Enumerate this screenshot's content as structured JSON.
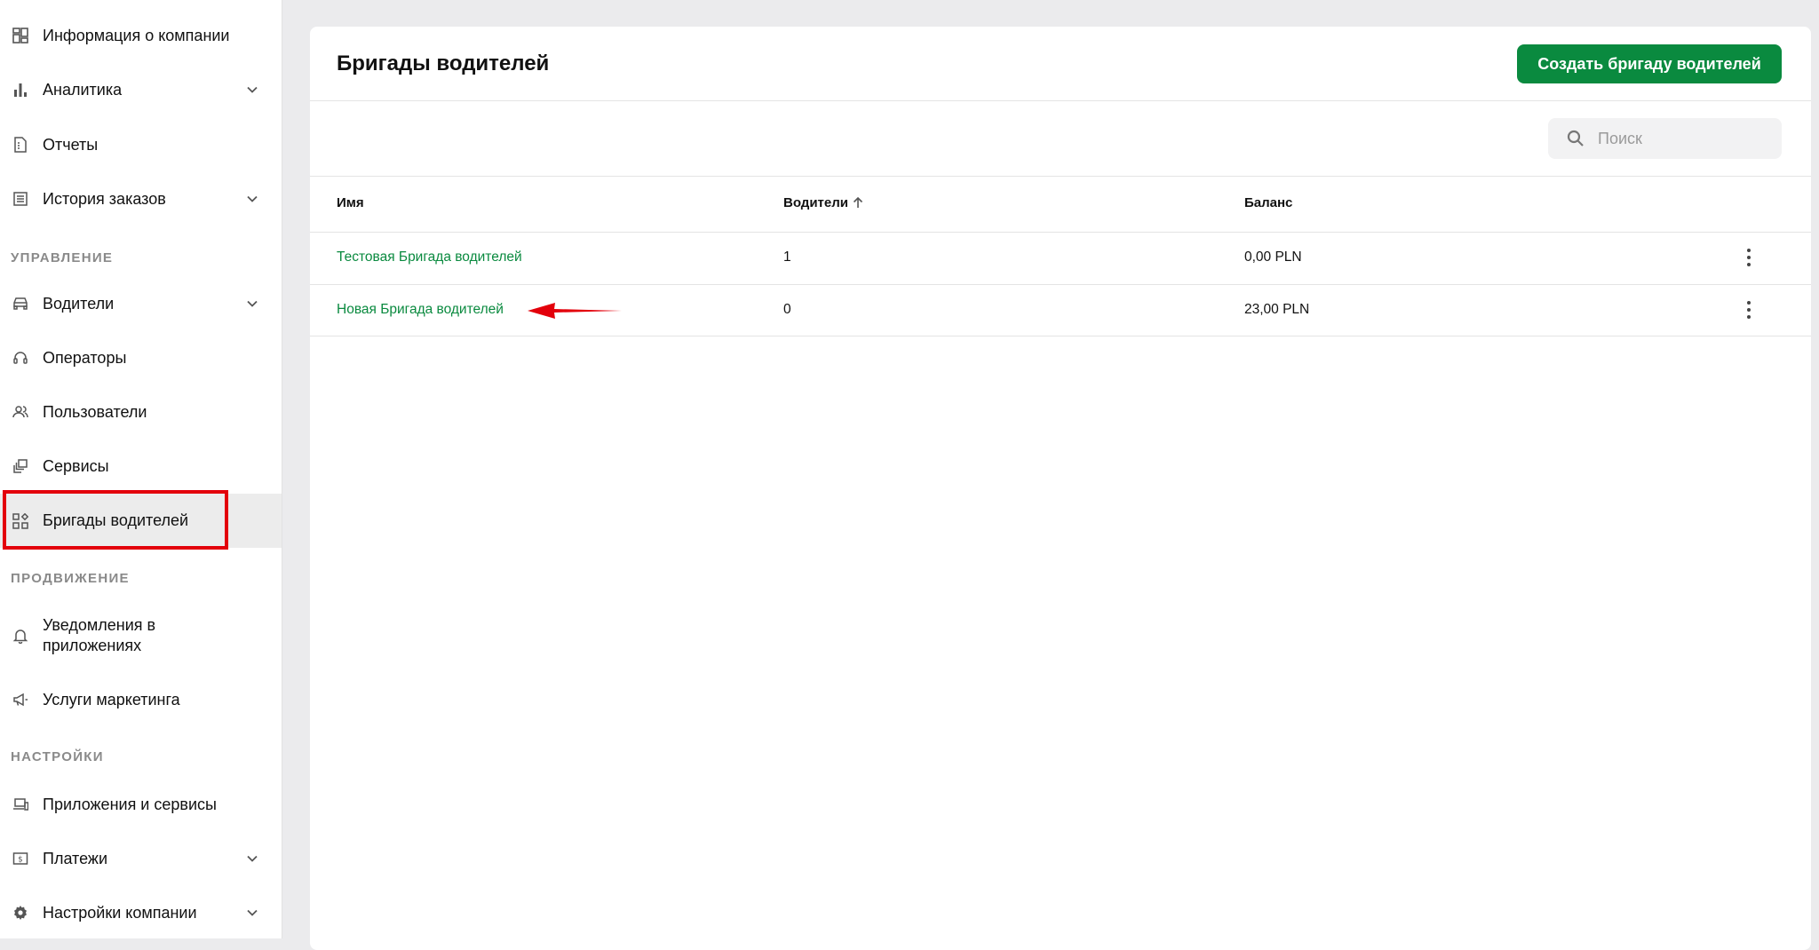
{
  "sidebar": {
    "items": [
      {
        "label": "Информация о компании"
      },
      {
        "label": "Аналитика"
      },
      {
        "label": "Отчеты"
      },
      {
        "label": "История заказов"
      },
      {
        "label": "Водители"
      },
      {
        "label": "Операторы"
      },
      {
        "label": "Пользователи"
      },
      {
        "label": "Сервисы"
      },
      {
        "label": "Бригады водителей"
      },
      {
        "label": "Уведомления в приложениях"
      },
      {
        "label": "Услуги маркетинга"
      },
      {
        "label": "Приложения и сервисы"
      },
      {
        "label": "Платежи"
      },
      {
        "label": "Настройки компании"
      }
    ],
    "sections": {
      "management": "УПРАВЛЕНИЕ",
      "promotion": "ПРОДВИЖЕНИЕ",
      "settings": "НАСТРОЙКИ"
    },
    "active_item": "Бригады водителей"
  },
  "main": {
    "title": "Бригады водителей",
    "create_button": "Создать бригаду водителей",
    "search": {
      "placeholder": "Поиск",
      "value": ""
    },
    "table": {
      "columns": [
        "Имя",
        "Водители",
        "Баланс"
      ],
      "sort_column": "Водители",
      "sort_direction": "ascending",
      "rows": [
        {
          "name": "Тестовая Бригада водителей",
          "drivers": "1",
          "balance": "0,00 PLN"
        },
        {
          "name": "Новая Бригада водителей",
          "drivers": "0",
          "balance": "23,00 PLN"
        }
      ]
    }
  },
  "colors": {
    "accent": "#0a8a3f",
    "annotation": "#e3000b",
    "background": "#ebebed"
  },
  "annotations": {
    "highlight_target": "Бригады водителей",
    "arrow_target": "Новая Бригада водителей"
  }
}
